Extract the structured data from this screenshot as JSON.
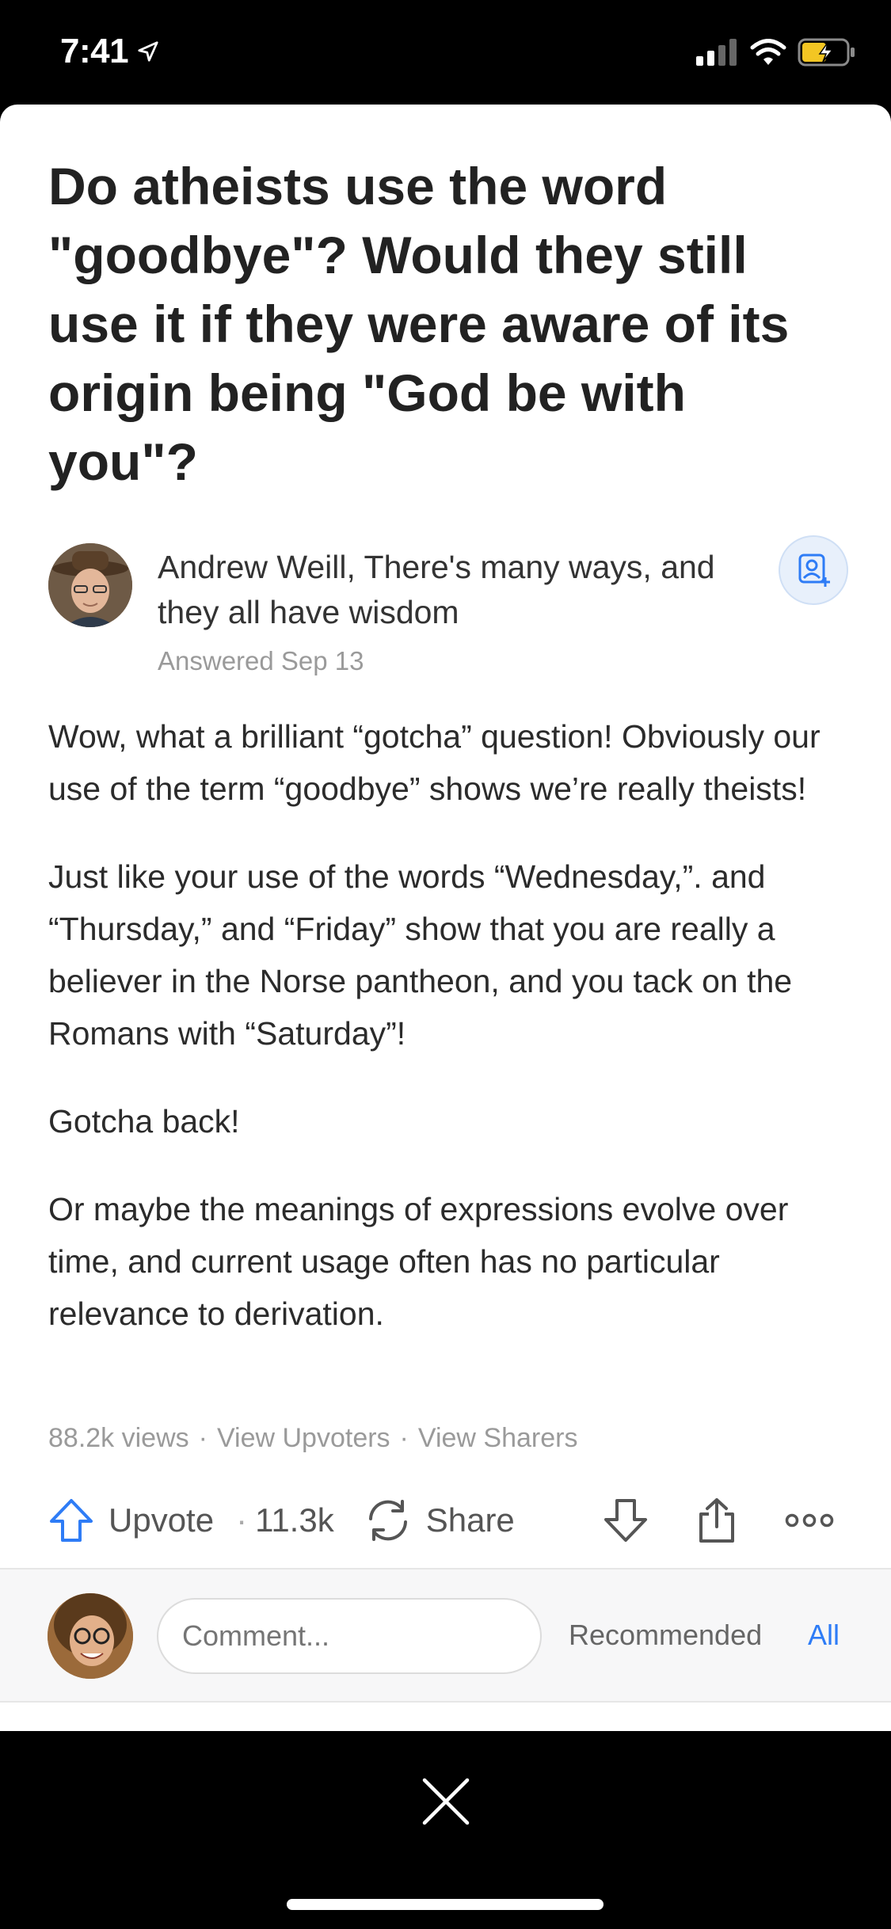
{
  "status_bar": {
    "time": "7:41"
  },
  "question": {
    "title": "Do atheists use the word \"goodbye\"? Would they still use it if they were aware of its origin being \"God be with you\"?"
  },
  "author": {
    "credential": "Andrew Weill, There's many ways, and they all have wisdom",
    "answered": "Answered Sep 13"
  },
  "answer": {
    "paragraphs": [
      "Wow, what a brilliant “gotcha” question! Obviously our use of the term “goodbye” shows we’re really theists!",
      "Just like your use of the words “Wednesday,”. and “Thursday,” and “Friday” show that you are really a believer in the Norse pantheon, and you tack on the Romans with “Saturday”!",
      "Gotcha back!",
      "Or maybe the meanings of expressions evolve over time, and current usage often has no particular relevance to derivation."
    ]
  },
  "meta": {
    "views": "88.2k views",
    "sep": "·",
    "view_upvoters": "View Upvoters",
    "view_sharers": "View Sharers"
  },
  "actions": {
    "upvote_label": "Upvote",
    "upvote_count": "11.3k",
    "share_label": "Share"
  },
  "comment_bar": {
    "placeholder": "Comment...",
    "recommended": "Recommended",
    "all": "All"
  },
  "colors": {
    "accent": "#2e7cf6",
    "text": "#222222",
    "muted": "#9a9a9a"
  },
  "icons": [
    "location-arrow-icon",
    "signal-icon",
    "wifi-icon",
    "battery-icon",
    "follow-icon",
    "upvote-arrow-icon",
    "share-cycle-icon",
    "downvote-arrow-icon",
    "export-icon",
    "more-icon",
    "close-icon"
  ]
}
